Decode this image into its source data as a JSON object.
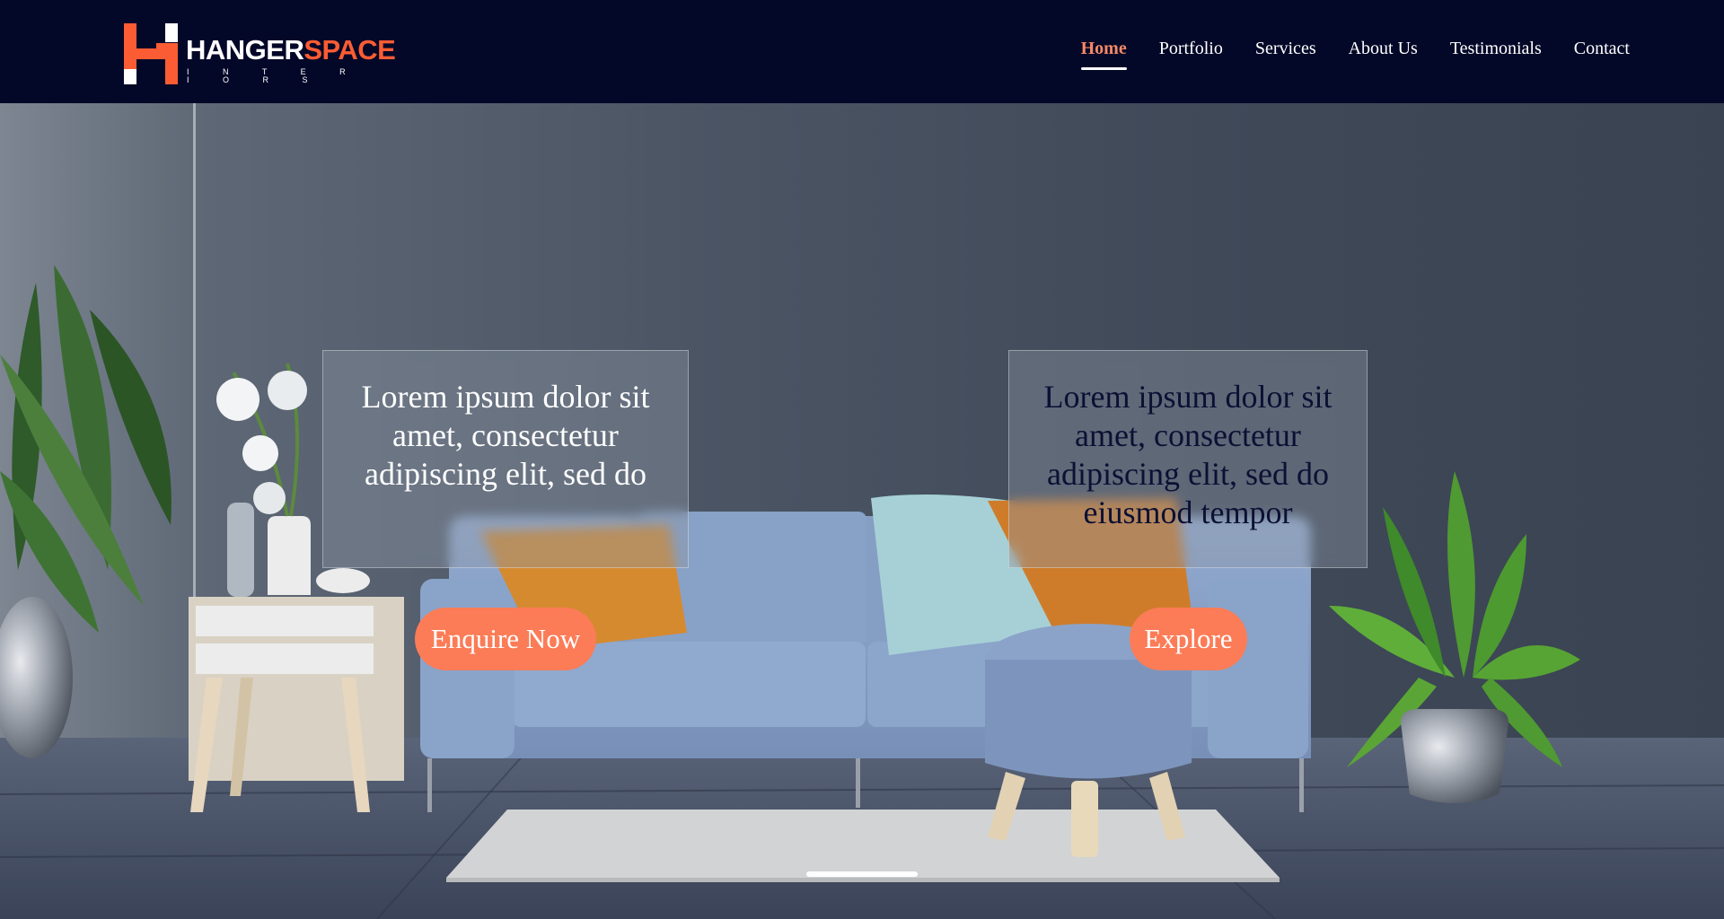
{
  "brand": {
    "name_part1": "HANGER",
    "name_part2": "SPACE",
    "tagline": "I N T E R I O R S",
    "accent_color": "#fb5c33"
  },
  "nav": {
    "items": [
      {
        "label": "Home",
        "active": true
      },
      {
        "label": "Portfolio",
        "active": false
      },
      {
        "label": "Services",
        "active": false
      },
      {
        "label": "About Us",
        "active": false
      },
      {
        "label": "Testimonials",
        "active": false
      },
      {
        "label": "Contact",
        "active": false
      }
    ],
    "active_color": "#f48a67",
    "background": "#040828"
  },
  "hero": {
    "cards": [
      {
        "text": "Lorem ipsum dolor sit amet, consectetur adipiscing elit, sed do"
      },
      {
        "text": "Lorem ipsum dolor sit amet, consectetur adipiscing elit, sed do eiusmod tempor"
      }
    ],
    "buttons": {
      "enquire_label": "Enquire Now",
      "explore_label": "Explore",
      "color": "#fb7c57"
    },
    "image_subject": "living-room-interior-with-blue-sofa"
  }
}
